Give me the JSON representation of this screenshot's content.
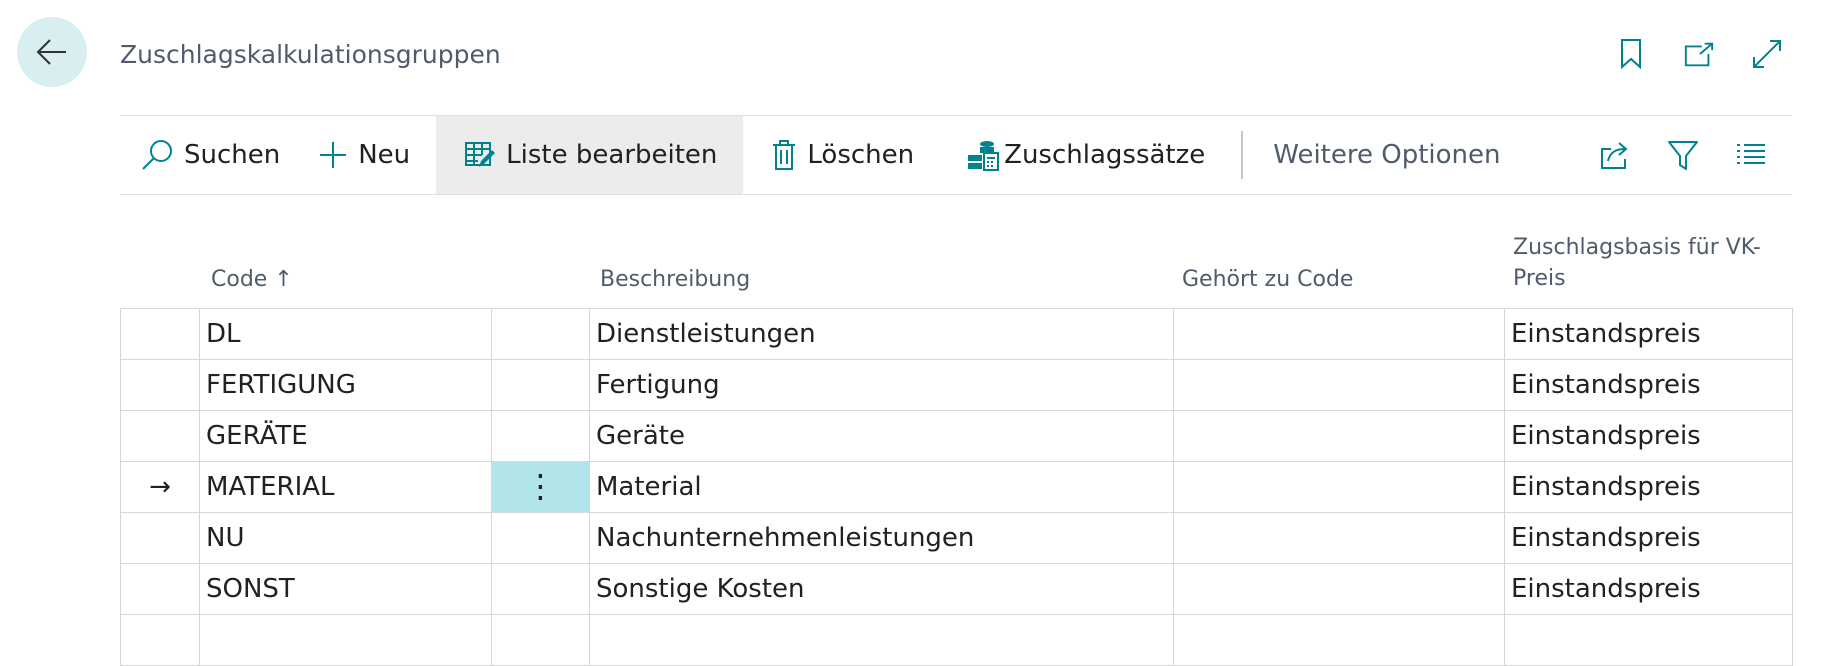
{
  "page": {
    "title": "Zuschlagskalkulationsgruppen"
  },
  "actions": {
    "search": "Suchen",
    "new": "Neu",
    "edit_list": "Liste bearbeiten",
    "delete": "Löschen",
    "rates": "Zuschlagssätze",
    "more": "Weitere Optionen"
  },
  "columns": {
    "code": "Code",
    "sort_indicator": "↑",
    "description": "Beschreibung",
    "belongs_to": "Gehört zu Code",
    "basis_line1": "Zuschlagsbasis für VK-",
    "basis_line2": "Preis"
  },
  "rows": [
    {
      "code": "DL",
      "description": "Dienstleistungen",
      "belongs_to": "",
      "basis": "Einstandspreis"
    },
    {
      "code": "FERTIGUNG",
      "description": "Fertigung",
      "belongs_to": "",
      "basis": "Einstandspreis"
    },
    {
      "code": "GERÄTE",
      "description": "Geräte",
      "belongs_to": "",
      "basis": "Einstandspreis"
    },
    {
      "code": "MATERIAL",
      "description": "Material",
      "belongs_to": "",
      "basis": "Einstandspreis"
    },
    {
      "code": "NU",
      "description": "Nachunternehmenleistungen",
      "belongs_to": "",
      "basis": "Einstandspreis"
    },
    {
      "code": "SONST",
      "description": "Sonstige Kosten",
      "belongs_to": "",
      "basis": "Einstandspreis"
    },
    {
      "code": "",
      "description": "",
      "belongs_to": "",
      "basis": ""
    }
  ],
  "current_row_marker": "→",
  "row_menu_glyph": "⋮",
  "colors": {
    "accent": "#00838f",
    "selected_cell": "#b2e5ea",
    "back_button_bg": "#d9eef0"
  },
  "icons": {
    "back": "arrow-left-icon",
    "bookmark": "bookmark-icon",
    "open_new_window": "open-in-new-window-icon",
    "expand": "expand-icon",
    "search": "search-icon",
    "new": "plus-icon",
    "edit_list": "edit-list-icon",
    "delete": "trash-icon",
    "rates": "coins-calculator-icon",
    "share": "share-icon",
    "filter": "filter-icon",
    "list_view": "list-view-icon"
  }
}
